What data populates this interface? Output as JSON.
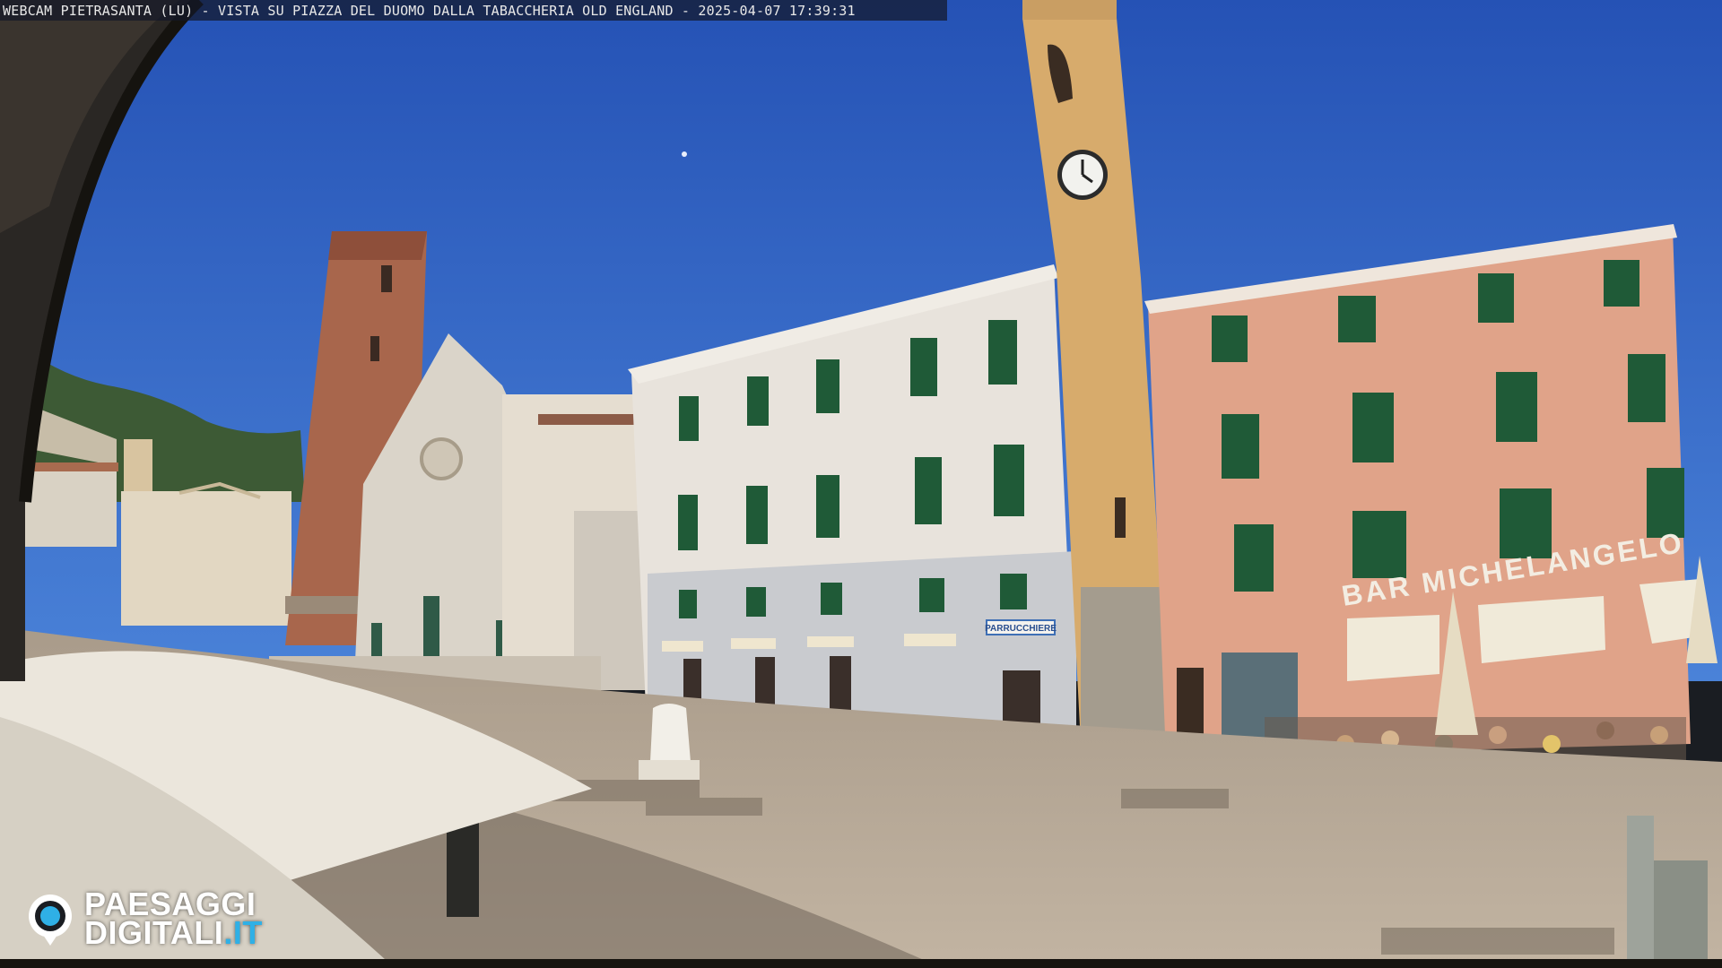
{
  "caption": {
    "text": "WEBCAM PIETRASANTA (LU) - VISTA SU PIAZZA DEL DUOMO DALLA TABACCHERIA OLD ENGLAND - 2025-04-07 17:39:31"
  },
  "signs": {
    "bar": "BAR MICHELANGELO",
    "barber": "PARRUCCHIERE"
  },
  "clock_icon": "clock-face-icon",
  "logo": {
    "line1": "PAESAGGI",
    "line2_main": "DIGITALI",
    "line2_accent": ".IT",
    "icon": "eye-logo-icon"
  },
  "colors": {
    "sky": "#2f5fbf",
    "brand_accent": "#2fb0e6",
    "salmon_facade": "#e0a389",
    "white_facade": "#e8e3dc",
    "pavement": "#b9aa97"
  }
}
